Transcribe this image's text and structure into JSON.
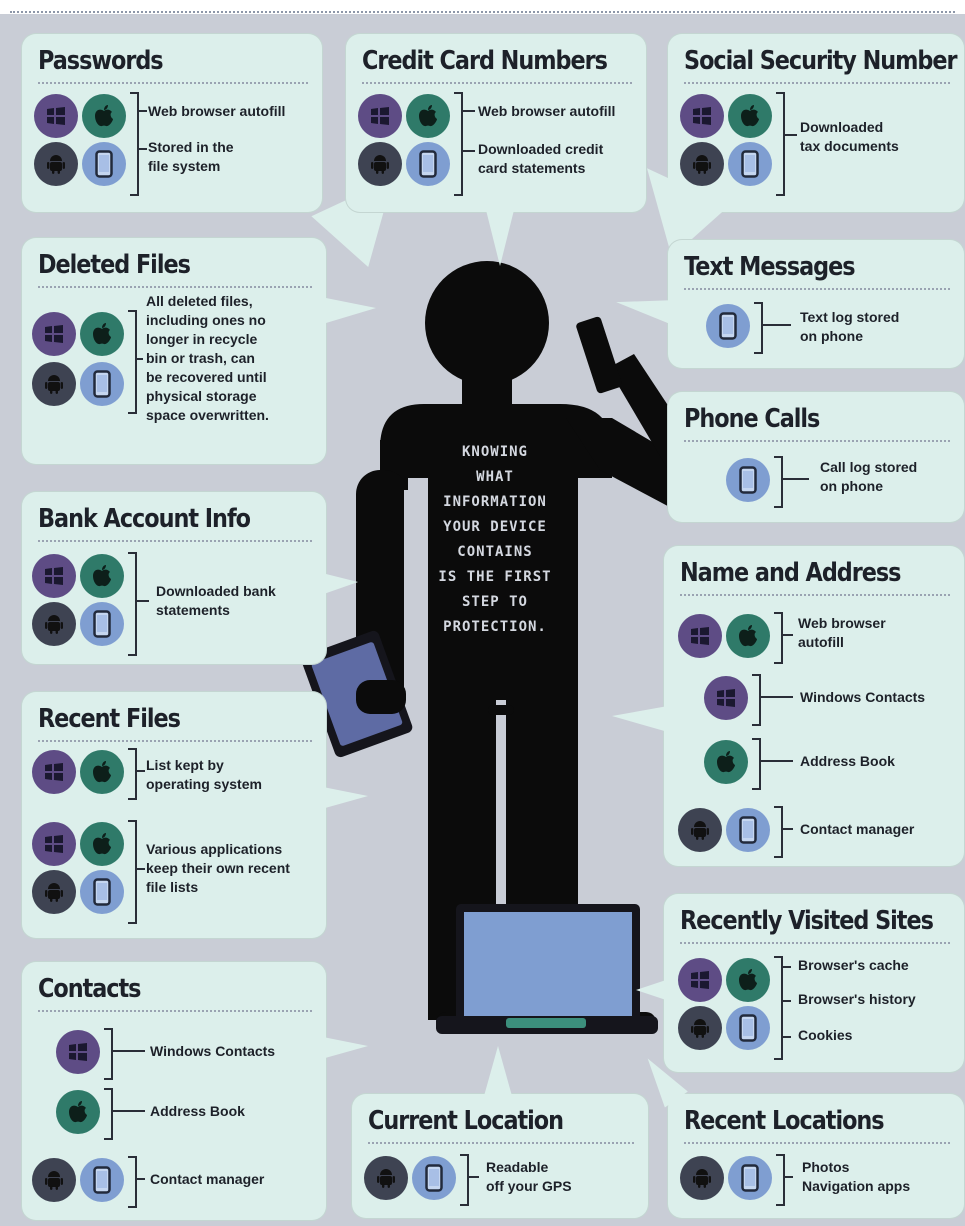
{
  "slogan": "KNOWING\nWHAT\nINFORMATION\nYOUR DEVICE\nCONTAINS\nIS THE FIRST\nSTEP TO\nPROTECTION.",
  "colors": {
    "background": "#c9cdd6",
    "bubble": "#dcefeb",
    "figure": "#0b0b0b",
    "windows": "#5e4c85",
    "apple": "#2f7a69",
    "android": "#3e4352",
    "ios": "#7f9ed1",
    "laptop_screen": "#7f9ed1"
  },
  "icons": {
    "windows": "windows-icon",
    "apple": "apple-icon",
    "android": "android-icon",
    "ios": "ios-phone-icon"
  },
  "passwords": {
    "title": "Passwords",
    "items": [
      "Web browser autofill",
      "Stored in the\nfile system"
    ]
  },
  "credit_card": {
    "title": "Credit Card Numbers",
    "items": [
      "Web browser autofill",
      "Downloaded credit\ncard statements"
    ]
  },
  "ssn": {
    "title": "Social Security Number",
    "items": [
      "Downloaded\ntax documents"
    ]
  },
  "deleted_files": {
    "title": "Deleted Files",
    "items": [
      "All deleted files,\nincluding ones no\nlonger in recycle\nbin or trash, can\nbe recovered until\nphysical storage\nspace overwritten."
    ]
  },
  "text_messages": {
    "title": "Text Messages",
    "items": [
      "Text log stored\non phone"
    ]
  },
  "phone_calls": {
    "title": "Phone Calls",
    "items": [
      "Call log stored\non phone"
    ]
  },
  "bank": {
    "title": "Bank Account Info",
    "items": [
      "Downloaded bank\nstatements"
    ]
  },
  "name_address": {
    "title": "Name and Address",
    "items": [
      "Web browser\nautofill",
      "Windows Contacts",
      "Address Book",
      "Contact manager"
    ]
  },
  "recent_files": {
    "title": "Recent Files",
    "items": [
      "List kept by\noperating system",
      "Various applications\nkeep their own recent\nfile lists"
    ]
  },
  "recent_sites": {
    "title": "Recently Visited Sites",
    "items": [
      "Browser's cache",
      "Browser's history",
      "Cookies"
    ]
  },
  "contacts": {
    "title": "Contacts",
    "items": [
      "Windows Contacts",
      "Address Book",
      "Contact manager"
    ]
  },
  "current_location": {
    "title": "Current Location",
    "items": [
      "Readable\noff your GPS"
    ]
  },
  "recent_locations": {
    "title": "Recent Locations",
    "items": [
      "Photos\nNavigation apps"
    ]
  }
}
